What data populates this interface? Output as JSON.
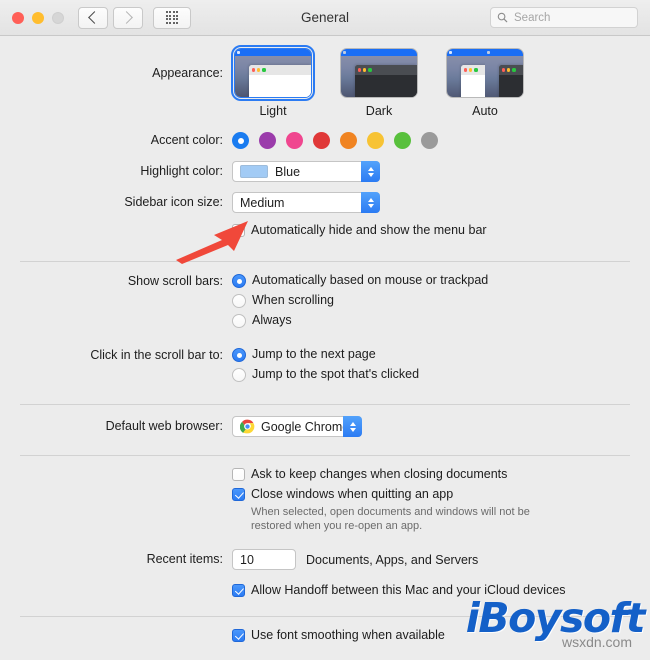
{
  "window": {
    "title": "General",
    "traffic_lights": [
      "close",
      "minimize",
      "zoom-disabled"
    ],
    "nav": {
      "back_icon": "chevron-left-icon",
      "forward_icon": "chevron-right-icon",
      "grid_icon": "grid-icon"
    },
    "search": {
      "placeholder": "Search",
      "value": "",
      "icon": "search-icon"
    }
  },
  "appearance": {
    "label": "Appearance:",
    "options": [
      {
        "name": "Light",
        "selected": true
      },
      {
        "name": "Dark",
        "selected": false
      },
      {
        "name": "Auto",
        "selected": false
      }
    ]
  },
  "accent_color": {
    "label": "Accent color:",
    "swatches": [
      {
        "name": "blue",
        "hex": "#1a7cf0",
        "selected": true
      },
      {
        "name": "purple",
        "hex": "#9b3cab",
        "selected": false
      },
      {
        "name": "pink",
        "hex": "#f0468f",
        "selected": false
      },
      {
        "name": "red",
        "hex": "#e03838",
        "selected": false
      },
      {
        "name": "orange",
        "hex": "#f08422",
        "selected": false
      },
      {
        "name": "yellow",
        "hex": "#f7c334",
        "selected": false
      },
      {
        "name": "green",
        "hex": "#58c03c",
        "selected": false
      },
      {
        "name": "graphite",
        "hex": "#9a9a9a",
        "selected": false
      }
    ]
  },
  "highlight_color": {
    "label": "Highlight color:",
    "value": "Blue",
    "swatch_hex": "#a2cbf5"
  },
  "sidebar_icon_size": {
    "label": "Sidebar icon size:",
    "value": "Medium"
  },
  "menu_bar": {
    "checkbox_label": "Automatically hide and show the menu bar",
    "checked": false
  },
  "annotation": {
    "arrow_color": "#f0483a",
    "points_to": "Automatically hide and show the menu bar"
  },
  "scroll_bars": {
    "label": "Show scroll bars:",
    "options": [
      {
        "label": "Automatically based on mouse or trackpad",
        "selected": true
      },
      {
        "label": "When scrolling",
        "selected": false
      },
      {
        "label": "Always",
        "selected": false
      }
    ]
  },
  "scroll_click": {
    "label": "Click in the scroll bar to:",
    "options": [
      {
        "label": "Jump to the next page",
        "selected": true
      },
      {
        "label": "Jump to the spot that's clicked",
        "selected": false
      }
    ]
  },
  "default_browser": {
    "label": "Default web browser:",
    "value": "Google Chrome",
    "icon": "chrome-icon"
  },
  "documents": {
    "ask_keep_changes": {
      "label": "Ask to keep changes when closing documents",
      "checked": false
    },
    "close_windows": {
      "label": "Close windows when quitting an app",
      "checked": true
    },
    "close_windows_help": "When selected, open documents and windows will not be restored when you re-open an app."
  },
  "recent_items": {
    "label": "Recent items:",
    "value": "10",
    "suffix": "Documents, Apps, and Servers"
  },
  "handoff": {
    "label": "Allow Handoff between this Mac and your iCloud devices",
    "checked": true
  },
  "font_smoothing": {
    "label": "Use font smoothing when available",
    "checked": true
  },
  "watermark": {
    "brand": "iBoysoft",
    "site": "wsxdn.com"
  }
}
